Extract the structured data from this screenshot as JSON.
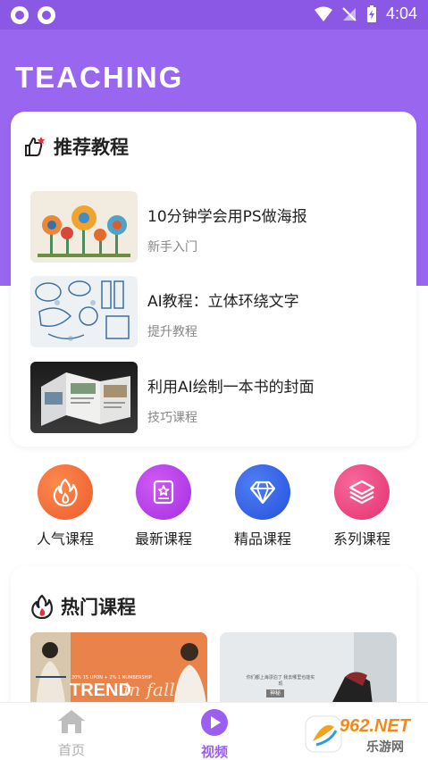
{
  "status_bar": {
    "time": "4:04"
  },
  "header": {
    "brand": "TEACHING"
  },
  "recommended": {
    "title": "推荐教程",
    "items": [
      {
        "name": "10分钟学会用PS做海报",
        "tag": "新手入门"
      },
      {
        "name": "AI教程：立体环绕文字",
        "tag": "提升教程"
      },
      {
        "name": "利用AI绘制一本书的封面",
        "tag": "技巧课程"
      }
    ]
  },
  "categories": [
    {
      "label": "人气课程",
      "icon": "flame-icon",
      "color": "#f46a3b"
    },
    {
      "label": "最新课程",
      "icon": "book-star-icon",
      "color": "#b53ee8"
    },
    {
      "label": "精品课程",
      "icon": "diamond-icon",
      "color": "#2f5fe8"
    },
    {
      "label": "系列课程",
      "icon": "layers-icon",
      "color": "#ee3f7a"
    }
  ],
  "hot": {
    "title": "热门课程",
    "cards": [
      {
        "headline": "TREND",
        "script": "in fall",
        "caption": "20% 15 UPON + 2% 1 NUMBERSHIP"
      },
      {
        "caption": "你们都上海漂泊了  我去哪里也能实现",
        "badge": "神秘"
      }
    ]
  },
  "nav": {
    "items": [
      {
        "label": "首页",
        "active": false
      },
      {
        "label": "视频",
        "active": true
      }
    ]
  },
  "watermark": {
    "text_main": "962.NET",
    "text_sub": "乐游网"
  },
  "colors": {
    "accent": "#9966f0",
    "statusbar": "#8b58e6",
    "nav_active": "#9a5ff0",
    "nav_inactive": "#b0b0b0"
  }
}
